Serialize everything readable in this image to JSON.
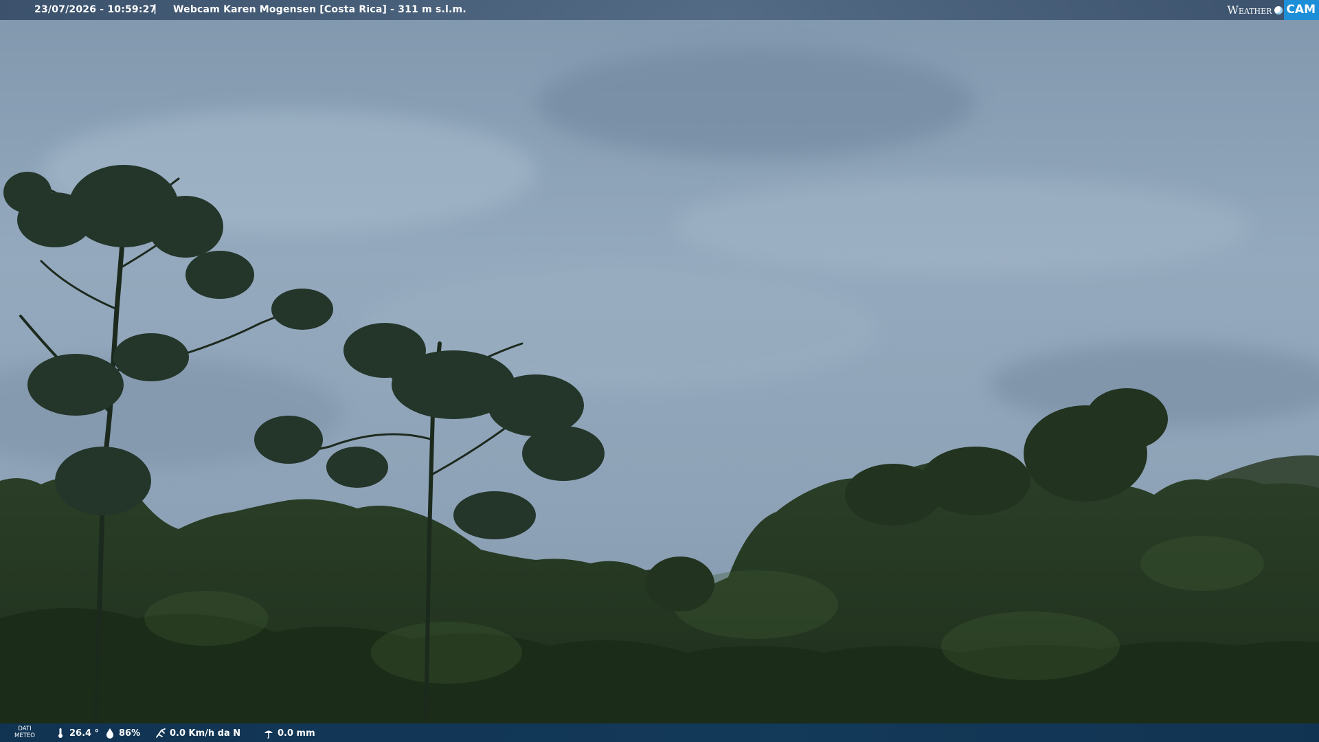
{
  "overlay": {
    "datetime": "23/07/2026 - 10:59:27",
    "separator": "|",
    "title": "Webcam Karen Mogensen [Costa Rica]  - 311 m s.l.m."
  },
  "logo": {
    "weather": "Weather",
    "cam": "CAM"
  },
  "meteo": {
    "label_line1": "DATI",
    "label_line2": "METEO",
    "temperature": "26.4 °",
    "humidity": "86%",
    "wind": "0.0 Km/h da N",
    "rain": "0.0 mm",
    "icons": [
      "thermometer-icon",
      "humidity-drop-icon",
      "wind-icon",
      "rain-gauge-icon"
    ]
  },
  "colors": {
    "top_bar": "#2f4866",
    "bottom_bar": "#123a62",
    "logo_cam_bg": "#1d8fd8",
    "sky": "#8fa5ba",
    "forest": "#24371f"
  }
}
